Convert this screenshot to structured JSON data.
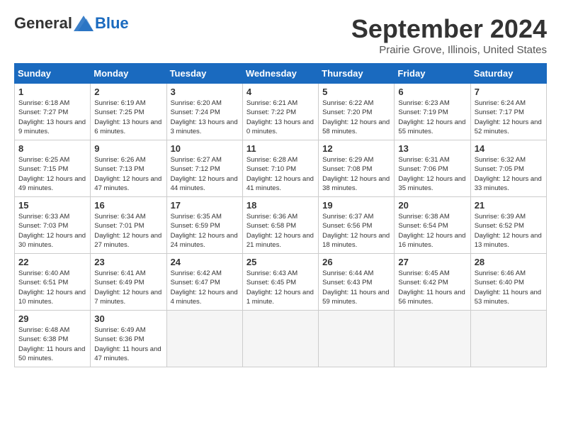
{
  "header": {
    "logo": {
      "general": "General",
      "blue": "Blue"
    },
    "title": "September 2024",
    "location": "Prairie Grove, Illinois, United States"
  },
  "weekdays": [
    "Sunday",
    "Monday",
    "Tuesday",
    "Wednesday",
    "Thursday",
    "Friday",
    "Saturday"
  ],
  "weeks": [
    [
      {
        "day": 1,
        "sunrise": "6:18 AM",
        "sunset": "7:27 PM",
        "daylight": "13 hours and 9 minutes."
      },
      {
        "day": 2,
        "sunrise": "6:19 AM",
        "sunset": "7:25 PM",
        "daylight": "13 hours and 6 minutes."
      },
      {
        "day": 3,
        "sunrise": "6:20 AM",
        "sunset": "7:24 PM",
        "daylight": "13 hours and 3 minutes."
      },
      {
        "day": 4,
        "sunrise": "6:21 AM",
        "sunset": "7:22 PM",
        "daylight": "13 hours and 0 minutes."
      },
      {
        "day": 5,
        "sunrise": "6:22 AM",
        "sunset": "7:20 PM",
        "daylight": "12 hours and 58 minutes."
      },
      {
        "day": 6,
        "sunrise": "6:23 AM",
        "sunset": "7:19 PM",
        "daylight": "12 hours and 55 minutes."
      },
      {
        "day": 7,
        "sunrise": "6:24 AM",
        "sunset": "7:17 PM",
        "daylight": "12 hours and 52 minutes."
      }
    ],
    [
      {
        "day": 8,
        "sunrise": "6:25 AM",
        "sunset": "7:15 PM",
        "daylight": "12 hours and 49 minutes."
      },
      {
        "day": 9,
        "sunrise": "6:26 AM",
        "sunset": "7:13 PM",
        "daylight": "12 hours and 47 minutes."
      },
      {
        "day": 10,
        "sunrise": "6:27 AM",
        "sunset": "7:12 PM",
        "daylight": "12 hours and 44 minutes."
      },
      {
        "day": 11,
        "sunrise": "6:28 AM",
        "sunset": "7:10 PM",
        "daylight": "12 hours and 41 minutes."
      },
      {
        "day": 12,
        "sunrise": "6:29 AM",
        "sunset": "7:08 PM",
        "daylight": "12 hours and 38 minutes."
      },
      {
        "day": 13,
        "sunrise": "6:31 AM",
        "sunset": "7:06 PM",
        "daylight": "12 hours and 35 minutes."
      },
      {
        "day": 14,
        "sunrise": "6:32 AM",
        "sunset": "7:05 PM",
        "daylight": "12 hours and 33 minutes."
      }
    ],
    [
      {
        "day": 15,
        "sunrise": "6:33 AM",
        "sunset": "7:03 PM",
        "daylight": "12 hours and 30 minutes."
      },
      {
        "day": 16,
        "sunrise": "6:34 AM",
        "sunset": "7:01 PM",
        "daylight": "12 hours and 27 minutes."
      },
      {
        "day": 17,
        "sunrise": "6:35 AM",
        "sunset": "6:59 PM",
        "daylight": "12 hours and 24 minutes."
      },
      {
        "day": 18,
        "sunrise": "6:36 AM",
        "sunset": "6:58 PM",
        "daylight": "12 hours and 21 minutes."
      },
      {
        "day": 19,
        "sunrise": "6:37 AM",
        "sunset": "6:56 PM",
        "daylight": "12 hours and 18 minutes."
      },
      {
        "day": 20,
        "sunrise": "6:38 AM",
        "sunset": "6:54 PM",
        "daylight": "12 hours and 16 minutes."
      },
      {
        "day": 21,
        "sunrise": "6:39 AM",
        "sunset": "6:52 PM",
        "daylight": "12 hours and 13 minutes."
      }
    ],
    [
      {
        "day": 22,
        "sunrise": "6:40 AM",
        "sunset": "6:51 PM",
        "daylight": "12 hours and 10 minutes."
      },
      {
        "day": 23,
        "sunrise": "6:41 AM",
        "sunset": "6:49 PM",
        "daylight": "12 hours and 7 minutes."
      },
      {
        "day": 24,
        "sunrise": "6:42 AM",
        "sunset": "6:47 PM",
        "daylight": "12 hours and 4 minutes."
      },
      {
        "day": 25,
        "sunrise": "6:43 AM",
        "sunset": "6:45 PM",
        "daylight": "12 hours and 1 minute."
      },
      {
        "day": 26,
        "sunrise": "6:44 AM",
        "sunset": "6:43 PM",
        "daylight": "11 hours and 59 minutes."
      },
      {
        "day": 27,
        "sunrise": "6:45 AM",
        "sunset": "6:42 PM",
        "daylight": "11 hours and 56 minutes."
      },
      {
        "day": 28,
        "sunrise": "6:46 AM",
        "sunset": "6:40 PM",
        "daylight": "11 hours and 53 minutes."
      }
    ],
    [
      {
        "day": 29,
        "sunrise": "6:48 AM",
        "sunset": "6:38 PM",
        "daylight": "11 hours and 50 minutes."
      },
      {
        "day": 30,
        "sunrise": "6:49 AM",
        "sunset": "6:36 PM",
        "daylight": "11 hours and 47 minutes."
      },
      null,
      null,
      null,
      null,
      null
    ]
  ]
}
